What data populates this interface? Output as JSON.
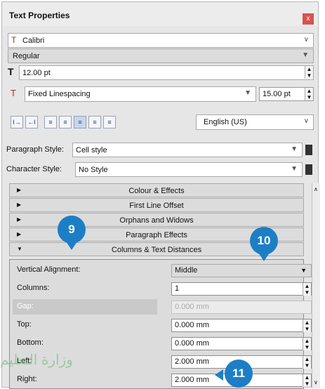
{
  "window": {
    "title": "Text Properties",
    "close_label": "x"
  },
  "font": {
    "name": "Calibri",
    "style": "Regular",
    "size": "12.00 pt"
  },
  "spacing": {
    "mode": "Fixed Linespacing",
    "value": "15.00 pt"
  },
  "language": "English (US)",
  "paragraph": {
    "label": "Paragraph Style:",
    "value": "Cell style"
  },
  "character": {
    "label": "Character Style:",
    "value": "No Style"
  },
  "sections": [
    {
      "label": "Colour & Effects"
    },
    {
      "label": "First Line Offset"
    },
    {
      "label": "Orphans and Widows"
    },
    {
      "label": "Paragraph Effects"
    },
    {
      "label": "Columns & Text Distances"
    }
  ],
  "columns_panel": {
    "vertical_alignment": {
      "label": "Vertical Alignment:",
      "value": "Middle"
    },
    "columns": {
      "label": "Columns:",
      "value": "1"
    },
    "gap": {
      "label": "Gap:",
      "value": "0.000 mm"
    },
    "top": {
      "label": "Top:",
      "value": "0.000 mm"
    },
    "bottom": {
      "label": "Bottom:",
      "value": "0.000 mm"
    },
    "left": {
      "label": "Left:",
      "value": "2.000 mm"
    },
    "right": {
      "label": "Right:",
      "value": "2.000 mm"
    }
  },
  "badges": [
    "9",
    "10",
    "11"
  ],
  "watermark": "وزارة التعليم"
}
